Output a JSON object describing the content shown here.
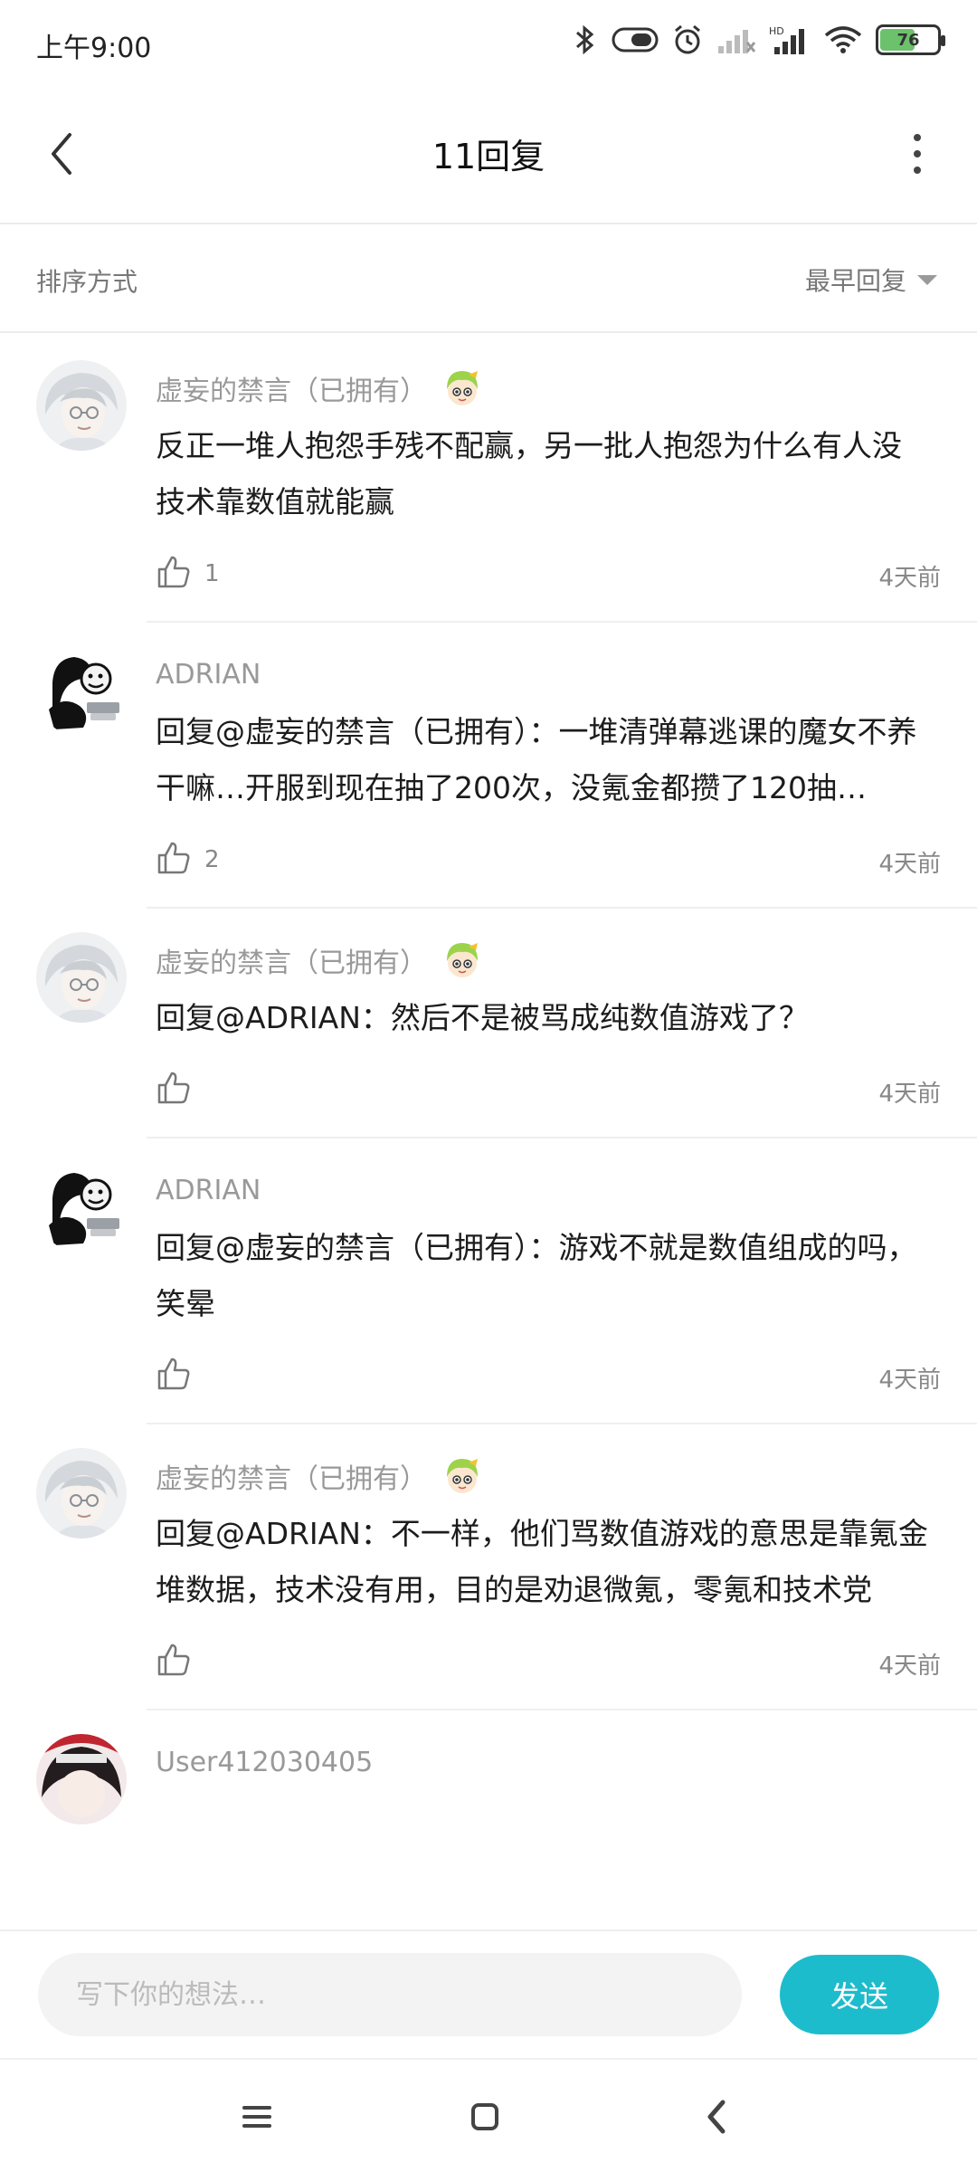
{
  "status_bar": {
    "time": "上午9:00",
    "battery_level": "76",
    "icons": [
      "bluetooth-icon",
      "vpn-icon",
      "alarm-icon",
      "signal-icon",
      "hd-signal-icon",
      "wifi-icon",
      "battery-icon"
    ]
  },
  "header": {
    "title": "11回复",
    "back_icon": "chevron-left-icon",
    "more_icon": "more-vertical-icon"
  },
  "sort": {
    "label": "排序方式",
    "selected": "最早回复"
  },
  "replies": [
    {
      "username": "虚妄的禁言（已拥有）",
      "avatar": "white-hair-avatar",
      "has_badge": true,
      "content": "反正一堆人抱怨手残不配赢，另一批人抱怨为什么有人没技术靠数值就能赢",
      "likes": "1",
      "time": "4天前"
    },
    {
      "username": "ADRIAN",
      "avatar": "meme-avatar",
      "has_badge": false,
      "content": "回复@虚妄的禁言（已拥有）：一堆清弹幕逃课的魔女不养干嘛…开服到现在抽了200次，没氪金都攒了120抽…",
      "likes": "2",
      "time": "4天前"
    },
    {
      "username": "虚妄的禁言（已拥有）",
      "avatar": "white-hair-avatar",
      "has_badge": true,
      "content": "回复@ADRIAN：然后不是被骂成纯数值游戏了？",
      "likes": "",
      "time": "4天前"
    },
    {
      "username": "ADRIAN",
      "avatar": "meme-avatar",
      "has_badge": false,
      "content": "回复@虚妄的禁言（已拥有）：游戏不就是数值组成的吗，笑晕",
      "likes": "",
      "time": "4天前"
    },
    {
      "username": "虚妄的禁言（已拥有）",
      "avatar": "white-hair-avatar",
      "has_badge": true,
      "content": "回复@ADRIAN：不一样，他们骂数值游戏的意思是靠氪金堆数据，技术没有用，目的是劝退微氪，零氪和技术党",
      "likes": "",
      "time": "4天前"
    },
    {
      "username": "User412030405",
      "avatar": "dark-hair-avatar",
      "has_badge": false,
      "content": "",
      "likes": "",
      "time": ""
    }
  ],
  "composer": {
    "placeholder": "写下你的想法…",
    "send_label": "发送"
  },
  "colors": {
    "accent": "#1dbccc",
    "secondary_text": "#999999",
    "divider": "#efefef"
  }
}
